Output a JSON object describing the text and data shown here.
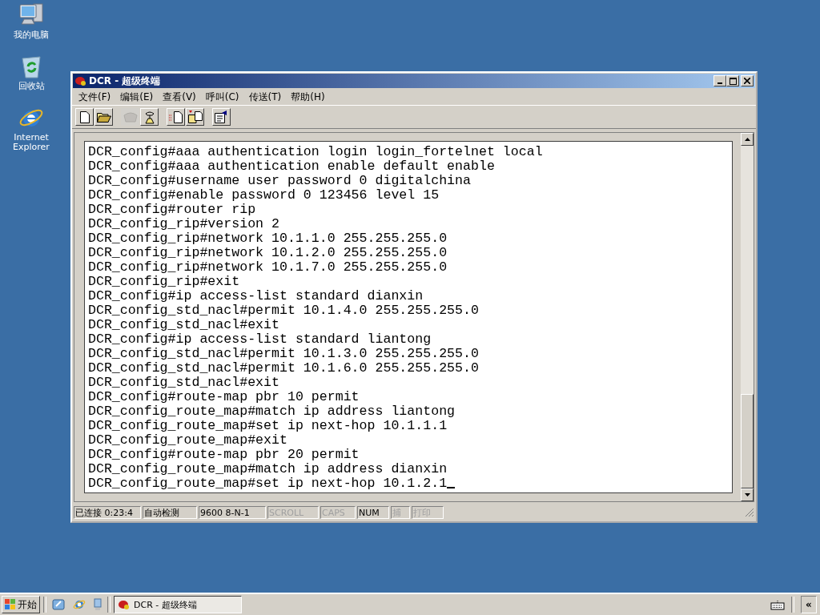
{
  "desktop_icons": [
    {
      "kind": "computer",
      "label": "我的电脑"
    },
    {
      "kind": "recycle",
      "label": "回收站"
    },
    {
      "kind": "browser",
      "label": "Internet Explorer"
    }
  ],
  "window": {
    "title": "DCR - 超级终端",
    "menu": [
      "文件(F)",
      "编辑(E)",
      "查看(V)",
      "呼叫(C)",
      "传送(T)",
      "帮助(H)"
    ],
    "toolbar": [
      {
        "kind": "new",
        "disabled": false
      },
      {
        "kind": "open",
        "disabled": false
      },
      {
        "kind": "separator"
      },
      {
        "kind": "call",
        "disabled": true
      },
      {
        "kind": "hangup",
        "disabled": false
      },
      {
        "kind": "separator"
      },
      {
        "kind": "send",
        "disabled": false
      },
      {
        "kind": "receive",
        "disabled": false
      },
      {
        "kind": "separator"
      },
      {
        "kind": "properties",
        "disabled": false
      }
    ],
    "terminal_lines": [
      "DCR_config#aaa authentication login login_fortelnet local",
      "DCR_config#aaa authentication enable default enable",
      "DCR_config#username user password 0 digitalchina",
      "DCR_config#enable password 0 123456 level 15",
      "DCR_config#router rip",
      "DCR_config_rip#version 2",
      "DCR_config_rip#network 10.1.1.0 255.255.255.0",
      "DCR_config_rip#network 10.1.2.0 255.255.255.0",
      "DCR_config_rip#network 10.1.7.0 255.255.255.0",
      "DCR_config_rip#exit",
      "DCR_config#ip access-list standard dianxin",
      "DCR_config_std_nacl#permit 10.1.4.0 255.255.255.0",
      "DCR_config_std_nacl#exit",
      "DCR_config#ip access-list standard liantong",
      "DCR_config_std_nacl#permit 10.1.3.0 255.255.255.0",
      "DCR_config_std_nacl#permit 10.1.6.0 255.255.255.0",
      "DCR_config_std_nacl#exit",
      "DCR_config#route-map pbr 10 permit",
      "DCR_config_route_map#match ip address liantong",
      "DCR_config_route_map#set ip next-hop 10.1.1.1",
      "DCR_config_route_map#exit",
      "DCR_config#route-map pbr 20 permit",
      "DCR_config_route_map#match ip address dianxin",
      "DCR_config_route_map#set ip next-hop 10.1.2.1"
    ],
    "cursor": true,
    "status_bar": [
      {
        "text": "已连接 0:23:4",
        "disabled": false
      },
      {
        "text": "自动检测",
        "disabled": false
      },
      {
        "text": "9600 8-N-1",
        "disabled": false
      },
      {
        "text": "SCROLL",
        "disabled": true
      },
      {
        "text": "CAPS",
        "disabled": true
      },
      {
        "text": "NUM",
        "disabled": false
      },
      {
        "text": "捕",
        "disabled": true
      },
      {
        "text": "打印",
        "disabled": true
      }
    ]
  },
  "taskbar": {
    "start": "开始",
    "quick_launch": [
      {
        "kind": "desktop"
      },
      {
        "kind": "browser"
      },
      {
        "kind": "app"
      }
    ],
    "tasks": [
      {
        "label": "DCR - 超级终端",
        "selected": true
      }
    ],
    "tray_toggle": "«"
  }
}
